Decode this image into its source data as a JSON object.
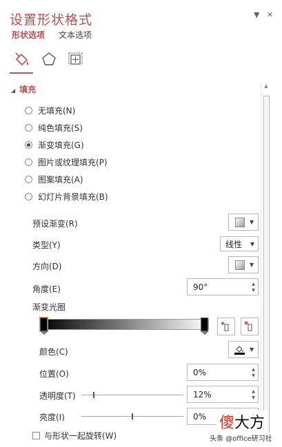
{
  "pane": {
    "title": "设置形状格式",
    "dropdown_glyph": "▼",
    "close_glyph": "✕",
    "tabs": [
      {
        "label": "形状选项",
        "active": true
      },
      {
        "label": "文本选项",
        "active": false
      }
    ],
    "icon_tabs": [
      "fill-line-icon",
      "effects-pentagon-icon",
      "size-properties-icon"
    ]
  },
  "section": {
    "title": "填充",
    "collapse_glyph": "◢"
  },
  "fill_options": [
    {
      "label": "无填充(N)",
      "selected": false
    },
    {
      "label": "纯色填充(S)",
      "selected": false
    },
    {
      "label": "渐变填充(G)",
      "selected": true
    },
    {
      "label": "图片或纹理填充(P)",
      "selected": false
    },
    {
      "label": "图案填充(A)",
      "selected": false
    },
    {
      "label": "幻灯片背景填充(B)",
      "selected": false
    }
  ],
  "gradient": {
    "preset_label": "预设渐变(R)",
    "type_label": "类型(Y)",
    "type_value": "线性",
    "direction_label": "方向(D)",
    "angle_label": "角度(E)",
    "angle_value": "90°",
    "stops_label": "渐变光圈",
    "color_label": "颜色(C)",
    "position_label": "位置(O)",
    "position_value": "0%",
    "transparency_label": "透明度(T)",
    "transparency_value": "12%",
    "transparency_fraction": 0.12,
    "brightness_label": "亮度(I)",
    "brightness_value": "0%",
    "brightness_fraction": 0.5,
    "rotate_label": "与形状一起旋转(W)"
  },
  "watermark": {
    "main_prefix": "傻",
    "main_suffix": "大方",
    "sub": "头条 @office研习社"
  },
  "colors": {
    "accent": "#c0504d"
  }
}
